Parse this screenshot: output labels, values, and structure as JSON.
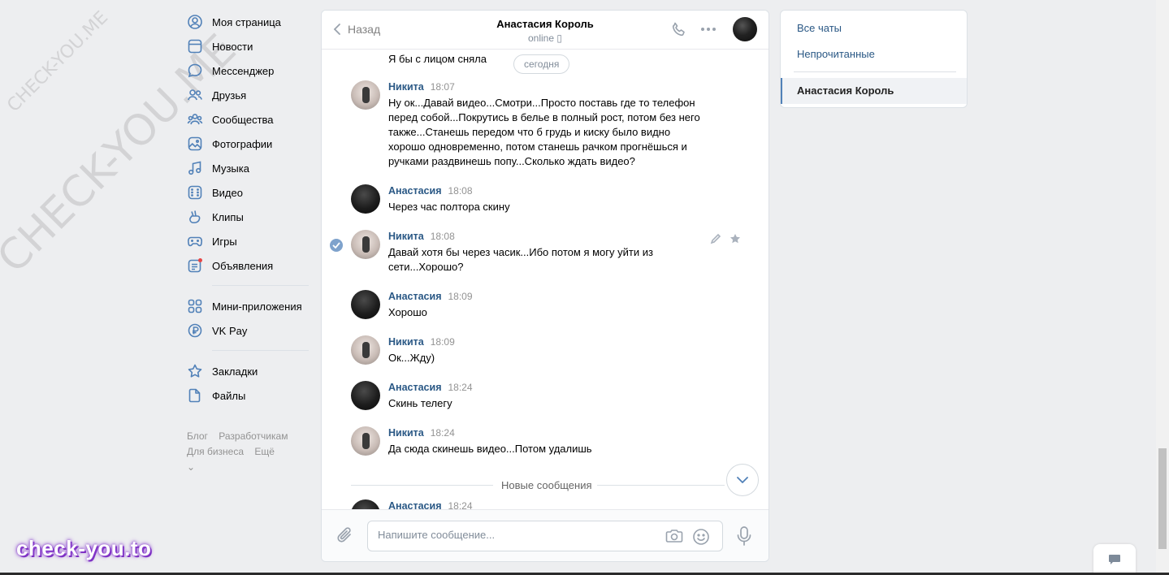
{
  "watermarks": {
    "small": "CHECK-YOU.ME",
    "big": "CHECK-YOU.ME",
    "brand": "check-you.to"
  },
  "nav": {
    "items": [
      {
        "label": "Моя страница",
        "icon": "user-circle-icon"
      },
      {
        "label": "Новости",
        "icon": "news-icon"
      },
      {
        "label": "Мессенджер",
        "icon": "messenger-icon"
      },
      {
        "label": "Друзья",
        "icon": "friends-icon"
      },
      {
        "label": "Сообщества",
        "icon": "communities-icon"
      },
      {
        "label": "Фотографии",
        "icon": "photo-icon"
      },
      {
        "label": "Музыка",
        "icon": "music-icon"
      },
      {
        "label": "Видео",
        "icon": "video-icon"
      },
      {
        "label": "Клипы",
        "icon": "clips-icon"
      },
      {
        "label": "Игры",
        "icon": "gamepad-icon"
      },
      {
        "label": "Объявления",
        "icon": "ads-icon"
      }
    ],
    "items2": [
      {
        "label": "Мини-приложения",
        "icon": "mini-apps-icon"
      },
      {
        "label": "VK Pay",
        "icon": "vkpay-icon"
      }
    ],
    "items3": [
      {
        "label": "Закладки",
        "icon": "bookmark-icon"
      },
      {
        "label": "Файлы",
        "icon": "file-icon"
      }
    ],
    "footer": {
      "blog": "Блог",
      "dev": "Разработчикам",
      "business": "Для бизнеса",
      "more": "Ещё"
    }
  },
  "chat": {
    "back_label": "Назад",
    "title": "Анастасия Король",
    "status": "online",
    "prev_text": "Я бы с лицом сняла",
    "today": "сегодня",
    "messages": [
      {
        "name": "Никита",
        "time": "18:07",
        "text": "Ну ок...Давай видео...Смотри...Просто поставь где то телефон перед собой...Покрутись в белье в полный рост, потом без него также...Станешь передом что б грудь и киску было видно хорошо одновременно, потом станешь рачком прогнёшься и ручками раздвинешь попу...Сколько ждать видео?"
      },
      {
        "name": "Анастасия",
        "time": "18:08",
        "text": "Через час полтора скину"
      },
      {
        "name": "Никита",
        "time": "18:08",
        "text": "Давай хотя бы через часик...Ибо потом я могу уйти из сети...Хорошо?"
      },
      {
        "name": "Анастасия",
        "time": "18:09",
        "text": "Хорошо"
      },
      {
        "name": "Никита",
        "time": "18:09",
        "text": "Ок...Жду)"
      },
      {
        "name": "Анастасия",
        "time": "18:24",
        "text": "Скинь телегу"
      },
      {
        "name": "Никита",
        "time": "18:24",
        "text": "Да сюда скинешь видео...Потом удалишь"
      },
      {
        "name": "Анастасия",
        "time": "18:24",
        "text": ""
      }
    ],
    "new_messages": "Новые сообщения",
    "composer_placeholder": "Напишите сообщение..."
  },
  "right_panel": {
    "all_chats": "Все чаты",
    "unread": "Непрочитанные",
    "active_chat": "Анастасия Король"
  },
  "colors": {
    "link": "#2a5885",
    "accent": "#5181b8",
    "background": "#edeef0"
  }
}
